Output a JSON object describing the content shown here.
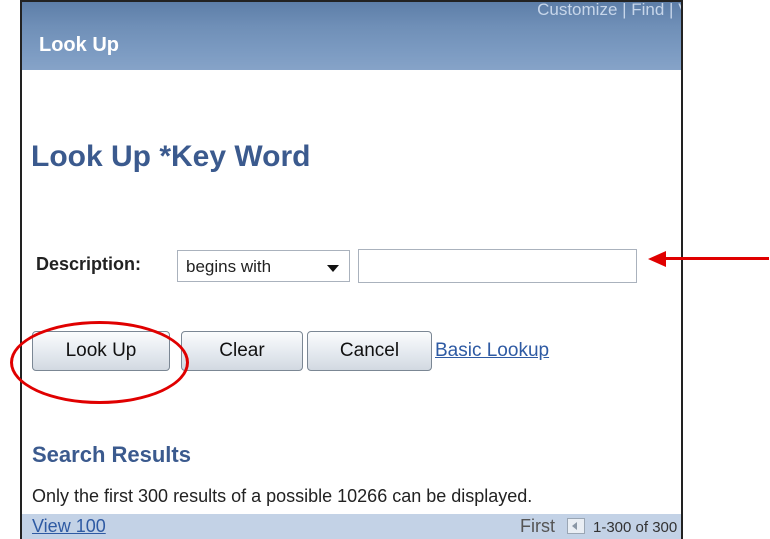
{
  "header": {
    "links_text": "Customize | Find | Vi",
    "title": "Look Up"
  },
  "page": {
    "title": "Look Up *Key Word"
  },
  "search": {
    "description_label": "Description:",
    "operator_value": "begins with",
    "description_value": ""
  },
  "buttons": {
    "lookup": "Look Up",
    "clear": "Clear",
    "cancel": "Cancel",
    "basic_lookup": "Basic Lookup"
  },
  "results": {
    "title": "Search Results",
    "message": "Only the first 300 results of a possible 10266 can be displayed.",
    "view_link": "View 100",
    "nav_first": "First",
    "nav_range": "1-300 of 300"
  },
  "annotations": {
    "color": "#e00000"
  }
}
